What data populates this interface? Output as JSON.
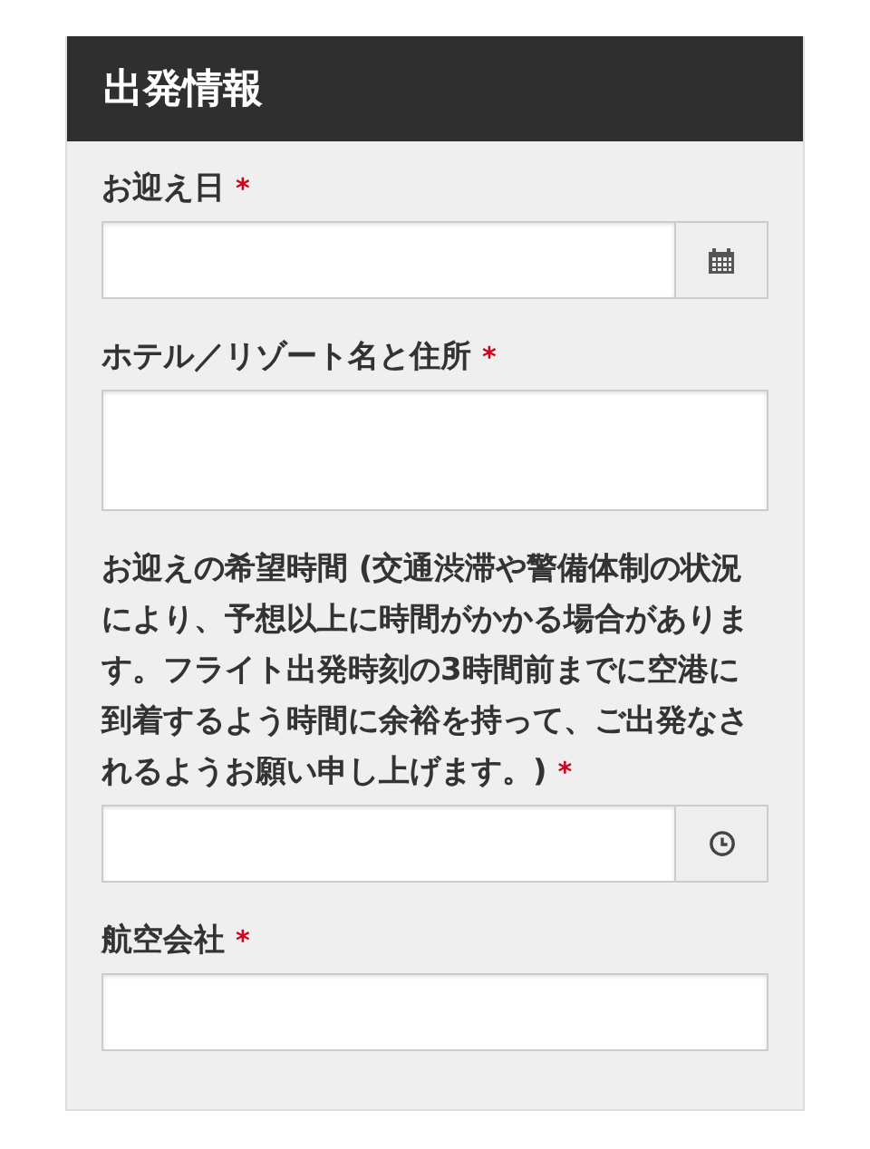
{
  "panel": {
    "title": "出発情報",
    "fields": [
      {
        "kind": "date",
        "label": "お迎え日",
        "required_mark": "*"
      },
      {
        "kind": "textarea",
        "label": "ホテル／リゾート名と住所",
        "required_mark": "*"
      },
      {
        "kind": "time",
        "label": "お迎えの希望時間 (交通渋滞や警備体制の状況により、予想以上に時間がかかる場合があります。フライト出発時刻の3時間前までに空港に到着するよう時間に余裕を持って、ご出発なされるようお願い申し上げます。)",
        "required_mark": "*"
      },
      {
        "kind": "text",
        "label": "航空会社",
        "required_mark": "*"
      }
    ]
  }
}
